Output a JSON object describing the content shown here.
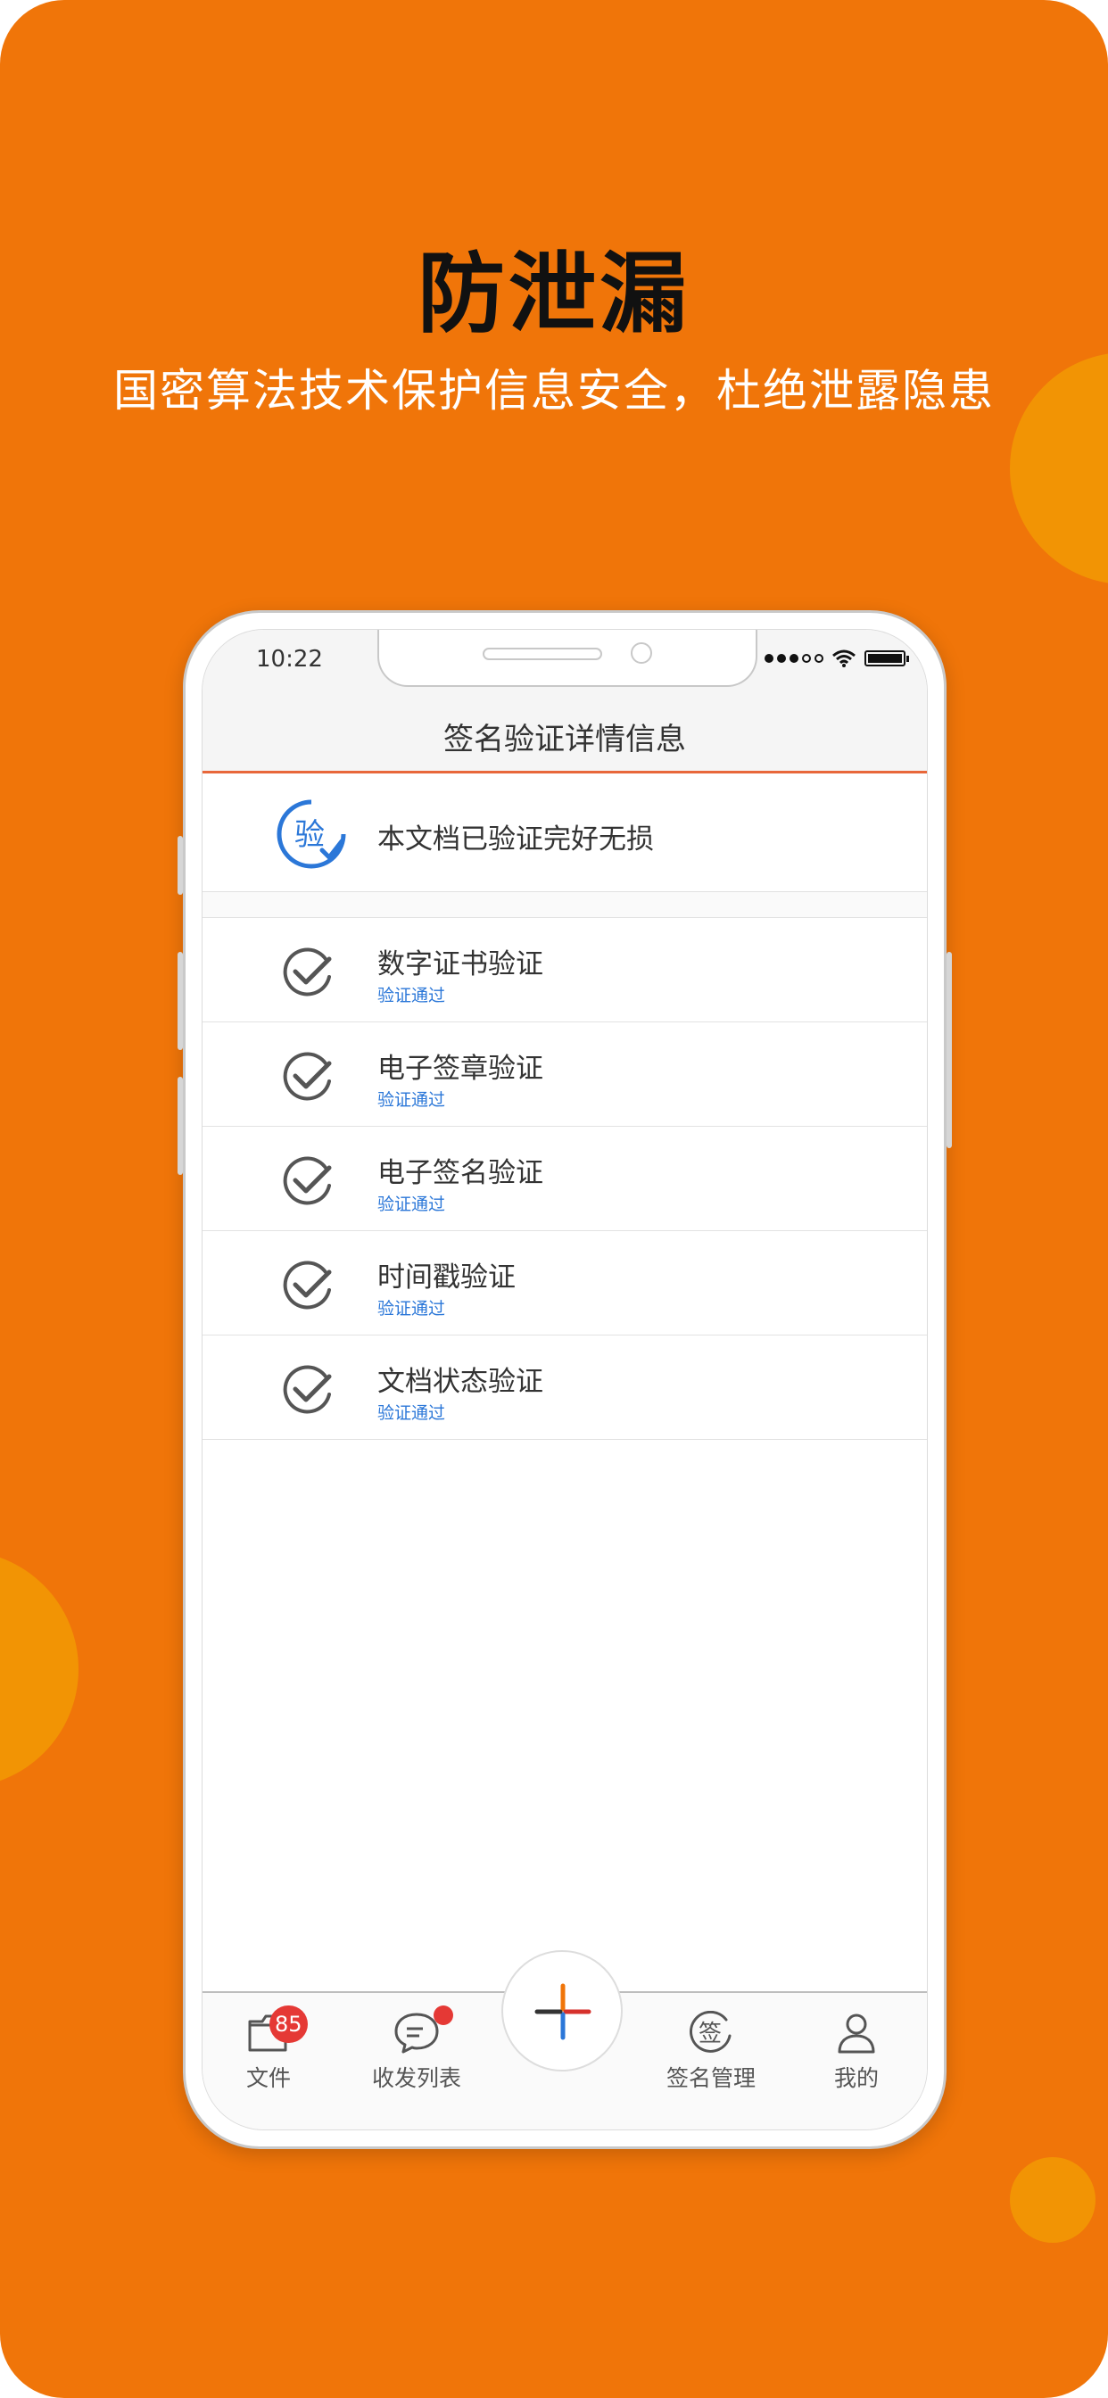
{
  "promo": {
    "headline": "防泄漏",
    "subline": "国密算法技术保护信息安全，杜绝泄露隐患"
  },
  "status_bar": {
    "time": "10:22",
    "icons": [
      "signal-dots-icon",
      "wifi-icon",
      "battery-icon"
    ]
  },
  "nav": {
    "title": "签名验证详情信息"
  },
  "summary": {
    "icon": "verify-seal-icon",
    "icon_char": "验",
    "text": "本文档已验证完好无损"
  },
  "checks": [
    {
      "title": "数字证书验证",
      "status": "验证通过"
    },
    {
      "title": "电子签章验证",
      "status": "验证通过"
    },
    {
      "title": "电子签名验证",
      "status": "验证通过"
    },
    {
      "title": "时间戳验证",
      "status": "验证通过"
    },
    {
      "title": "文档状态验证",
      "status": "验证通过"
    }
  ],
  "tab_bar": {
    "files": {
      "label": "文件",
      "badge": "85",
      "icon": "folder-icon"
    },
    "inbox": {
      "label": "收发列表",
      "icon": "chat-bubble-icon"
    },
    "center": {
      "icon": "plus-icon"
    },
    "signatures": {
      "label": "签名管理",
      "icon": "sign-stamp-icon",
      "icon_char": "签"
    },
    "profile": {
      "label": "我的",
      "icon": "user-icon"
    }
  },
  "colors": {
    "background": "#f07509",
    "decor_circle": "#f29404",
    "accent_line": "#e8673a",
    "status_blue": "#2b77d8",
    "badge_red": "#e53935"
  }
}
